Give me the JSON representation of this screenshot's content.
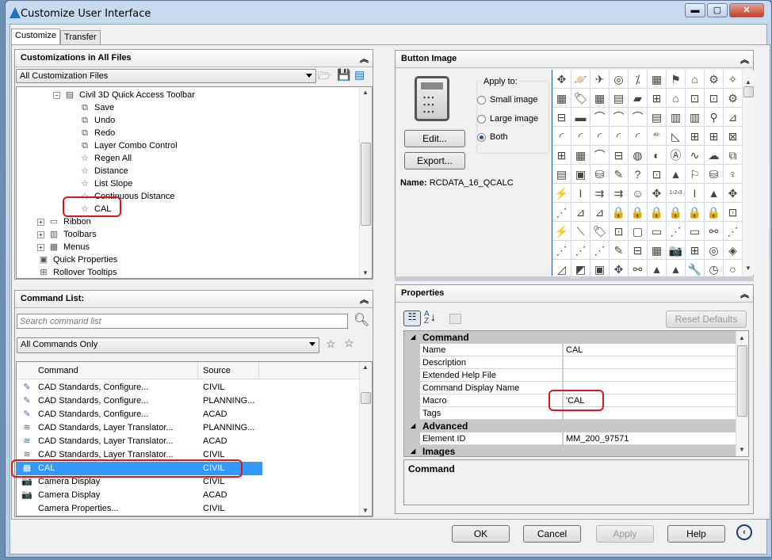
{
  "window": {
    "title": "Customize User Interface",
    "minimize": "▬",
    "maximize": "▢",
    "close": "✕"
  },
  "tabs": [
    {
      "label": "Customize",
      "active": true
    },
    {
      "label": "Transfer",
      "active": false
    }
  ],
  "customizations": {
    "header": "Customizations in All Files",
    "file_select": "All Customization Files",
    "tree": [
      {
        "label": "Civil 3D Quick Access Toolbar",
        "icon": "toolbar-icon",
        "level": 2,
        "expander": "−"
      },
      {
        "label": "Save",
        "icon": "button-icon",
        "level": 3
      },
      {
        "label": "Undo",
        "icon": "button-icon",
        "level": 3
      },
      {
        "label": "Redo",
        "icon": "button-icon",
        "level": 3
      },
      {
        "label": "Layer Combo Control",
        "icon": "button-icon",
        "level": 3
      },
      {
        "label": "Regen All",
        "icon": "star-icon",
        "level": 3
      },
      {
        "label": "Distance",
        "icon": "star-icon",
        "level": 3
      },
      {
        "label": "List Slope",
        "icon": "star-icon",
        "level": 3
      },
      {
        "label": "Continuous Distance",
        "icon": "star-icon",
        "level": 3
      },
      {
        "label": "CAL",
        "icon": "star-icon",
        "level": 3,
        "highlighted": true
      },
      {
        "label": "Ribbon",
        "icon": "ribbon-icon",
        "level": 1,
        "expander": "+"
      },
      {
        "label": "Toolbars",
        "icon": "toolbars-icon",
        "level": 1,
        "expander": "+"
      },
      {
        "label": "Menus",
        "icon": "menus-icon",
        "level": 1,
        "expander": "+"
      },
      {
        "label": "Quick Properties",
        "icon": "quick-properties-icon",
        "level": 1
      },
      {
        "label": "Rollover Tooltips",
        "icon": "rollover-tooltips-icon",
        "level": 1
      }
    ]
  },
  "command_list": {
    "header": "Command List:",
    "search_placeholder": "Search command list",
    "filter": "All Commands Only",
    "columns": [
      "Command",
      "Source"
    ],
    "rows": [
      {
        "command": "CAD Standards, Configure...",
        "source": "CIVIL",
        "icon": "standards-configure-icon"
      },
      {
        "command": "CAD Standards, Configure...",
        "source": "PLANNING...",
        "icon": "standards-configure-icon"
      },
      {
        "command": "CAD Standards, Configure...",
        "source": "ACAD",
        "icon": "standards-configure-icon"
      },
      {
        "command": "CAD Standards, Layer Translator...",
        "source": "PLANNING...",
        "icon": "layer-translator-icon"
      },
      {
        "command": "CAD Standards, Layer Translator...",
        "source": "ACAD",
        "icon": "layer-translator-icon"
      },
      {
        "command": "CAD Standards, Layer Translator...",
        "source": "CIVIL",
        "icon": "layer-translator-icon"
      },
      {
        "command": "CAL",
        "source": "CIVIL",
        "icon": "calculator-icon",
        "selected": true
      },
      {
        "command": "Camera Display",
        "source": "CIVIL",
        "icon": "camera-icon"
      },
      {
        "command": "Camera Display",
        "source": "ACAD",
        "icon": "camera-icon"
      },
      {
        "command": "Camera Properties...",
        "source": "CIVIL",
        "icon": ""
      }
    ]
  },
  "button_image": {
    "header": "Button Image",
    "apply_to_label": "Apply to:",
    "options": [
      {
        "label": "Small image",
        "selected": false
      },
      {
        "label": "Large image",
        "selected": false
      },
      {
        "label": "Both",
        "selected": true
      }
    ],
    "edit_button": "Edit...",
    "export_button": "Export...",
    "name_label": "Name:",
    "name_value": "RCDATA_16_QCALC",
    "icon_grid": [
      "✥",
      "🪐",
      "✈",
      "◎",
      "⁒",
      "▦",
      "⚑",
      "⌂",
      "⚙",
      "✧",
      "▦",
      "🏷",
      "▦",
      "▤",
      "▰",
      "⊞",
      "⌂",
      "⊡",
      "⊡",
      "⚙",
      "⊟",
      "▬",
      "⌒",
      "⌒",
      "⌒",
      "▤",
      "▥",
      "▥",
      "⚲",
      "⊿",
      "◜",
      "◜",
      "◜",
      "◜",
      "◜",
      "ᴬᴮᶜ",
      "◺",
      "⊞",
      "⊞",
      "⊠",
      "⊞",
      "▦",
      "⌒",
      "⊟",
      "◍",
      "◐",
      "Ⓐ",
      "∿",
      "☁",
      "⧉",
      "▤",
      "▣",
      "⛁",
      "✎",
      "?",
      "⊡",
      "▲",
      "⚐",
      "⛁",
      "♀",
      "⚡",
      "I",
      "⇉",
      "⇉",
      "☺",
      "✥",
      "1›2›3",
      "I",
      "▲",
      "✥",
      "⋰",
      "⊿",
      "⊿",
      "🔒",
      "🔒",
      "🔒",
      "🔒",
      "🔒",
      "🔒",
      "⊡",
      "⚡",
      "⟍",
      "🏷",
      "⊡",
      "▢",
      "▭",
      "⋰",
      "▭",
      "⚯",
      "⋰",
      "⋰",
      "⋰",
      "⋰",
      "✎",
      "⊟",
      "▦",
      "📷",
      "⊞",
      "◎",
      "◈",
      "◿",
      "◩",
      "▣",
      "✥",
      "⚯",
      "▲",
      "▲",
      "🔧",
      "◷",
      "○"
    ]
  },
  "properties": {
    "header": "Properties",
    "reset_defaults": "Reset Defaults",
    "groups": [
      {
        "name": "Command",
        "items": [
          {
            "key": "Name",
            "value": "CAL"
          },
          {
            "key": "Description",
            "value": ""
          },
          {
            "key": "Extended Help File",
            "value": ""
          },
          {
            "key": "Command Display Name",
            "value": ""
          },
          {
            "key": "Macro",
            "value": "'CAL"
          },
          {
            "key": "Tags",
            "value": ""
          }
        ]
      },
      {
        "name": "Advanced",
        "items": [
          {
            "key": "Element ID",
            "value": "MM_200_97571"
          }
        ]
      },
      {
        "name": "Images",
        "items": []
      }
    ],
    "description_title": "Command"
  },
  "footer": {
    "ok": "OK",
    "cancel": "Cancel",
    "apply": "Apply",
    "help": "Help"
  },
  "colors": {
    "selection": "#3399ff",
    "highlight_outline": "#e0141e"
  }
}
